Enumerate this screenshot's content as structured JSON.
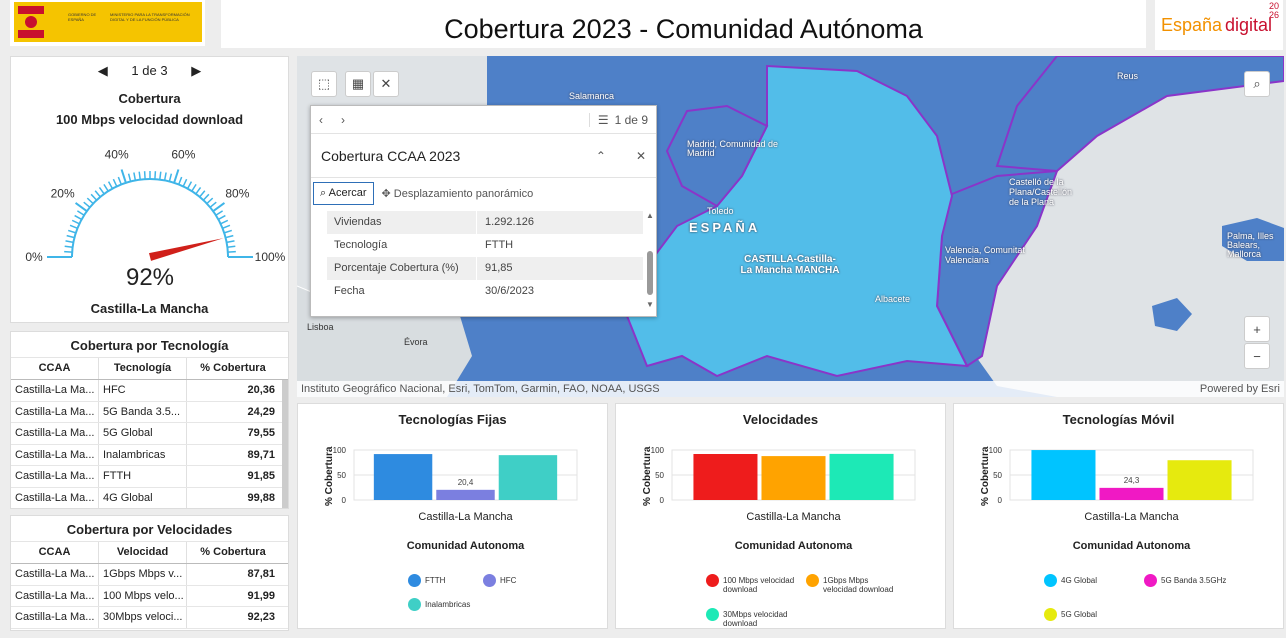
{
  "header": {
    "title": "Cobertura 2023 - Comunidad Autónoma",
    "left_logo_text_1": "GOBIERNO DE ESPAÑA",
    "left_logo_text_2": "MINISTERIO PARA LA TRANSFORMACIÓN DIGITAL Y DE LA FUNCIÓN PÚBLICA",
    "right_logo_text_1": "España",
    "right_logo_text_2": "digital",
    "right_logo_year": "2026"
  },
  "gauge": {
    "pager_label": "1 de 3",
    "title": "Cobertura",
    "subtitle": "100 Mbps velocidad download",
    "value": 92,
    "value_label": "92%",
    "ticks": [
      "0%",
      "20%",
      "40%",
      "60%",
      "80%",
      "100%"
    ],
    "region": "Castilla-La Mancha",
    "accent": "#3fb5e8",
    "needle": "#d0201a"
  },
  "tech_table": {
    "title": "Cobertura por Tecnología",
    "headers": [
      "CCAA",
      "Tecnología",
      "% Cobertura"
    ],
    "rows": [
      [
        "Castilla-La Ma...",
        "HFC",
        "20,36"
      ],
      [
        "Castilla-La Ma...",
        "5G Banda 3.5...",
        "24,29"
      ],
      [
        "Castilla-La Ma...",
        "5G Global",
        "79,55"
      ],
      [
        "Castilla-La Ma...",
        "Inalambricas",
        "89,71"
      ],
      [
        "Castilla-La Ma...",
        "FTTH",
        "91,85"
      ],
      [
        "Castilla-La Ma...",
        "4G Global",
        "99,88"
      ]
    ]
  },
  "speed_table": {
    "title": "Cobertura por Velocidades",
    "headers": [
      "CCAA",
      "Velocidad",
      "% Cobertura"
    ],
    "rows": [
      [
        "Castilla-La Ma...",
        "1Gbps Mbps v...",
        "87,81"
      ],
      [
        "Castilla-La Ma...",
        "100 Mbps velo...",
        "91,99"
      ],
      [
        "Castilla-La Ma...",
        "30Mbps veloci...",
        "92,23"
      ]
    ]
  },
  "map": {
    "attribution": "Instituto Geográfico Nacional, Esri, TomTom, Garmin, FAO, NOAA, USGS",
    "powered": "Powered by Esri",
    "labels": [
      "Salamanca",
      "Madrid, Comunidad de Madrid",
      "Toledo",
      "ESPAÑA",
      "CASTILLA-Castilla-La Mancha MANCHA",
      "Albacete",
      "Castelló de la Plana/Castellón de la Plana",
      "Valencia, Comunitat Valenciana",
      "Reus",
      "Palma, Illes Balears, Mallorca",
      "Lisboa",
      "Évora"
    ],
    "zoom_in": "+",
    "zoom_out": "−",
    "colors": {
      "sea": "#dfe3e6",
      "region": "#4e80c8",
      "selected": "#52bde9",
      "border": "#8a35c9"
    }
  },
  "popup": {
    "pager": "1 de 9",
    "title": "Cobertura CCAA 2023",
    "zoom_label": "Acercar",
    "pan_label": "Desplazamiento panorámico",
    "fields": [
      [
        "Viviendas",
        "1.292.126"
      ],
      [
        "Tecnología",
        "FTTH"
      ],
      [
        "Porcentaje Cobertura (%)",
        "91,85"
      ],
      [
        "Fecha",
        "30/6/2023"
      ]
    ]
  },
  "charts": {
    "fixed": {
      "title": "Tecnologías Fijas",
      "ylabel": "% Cobertura",
      "category": "Castilla-La Mancha",
      "xtitle": "Comunidad Autonoma",
      "legend": [
        "FTTH",
        "HFC",
        "Inalambricas"
      ]
    },
    "speeds": {
      "title": "Velocidades",
      "ylabel": "% Cobertura",
      "category": "Castilla-La Mancha",
      "xtitle": "Comunidad Autonoma",
      "legend": [
        "100 Mbps velocidad download",
        "1Gbps Mbps velocidad download",
        "30Mbps velocidad download"
      ]
    },
    "mobile": {
      "title": "Tecnologías Móvil",
      "ylabel": "% Cobertura",
      "category": "Castilla-La Mancha",
      "xtitle": "Comunidad Autonoma",
      "legend": [
        "4G Global",
        "5G Banda 3.5GHz",
        "5G Global"
      ]
    }
  },
  "chart_data": [
    {
      "type": "bar",
      "title": "Tecnologías Fijas",
      "ylabel": "% Cobertura",
      "xlabel": "Comunidad Autonoma",
      "categories": [
        "Castilla-La Mancha"
      ],
      "ylim": [
        0,
        100
      ],
      "ticks": [
        0,
        50,
        100
      ],
      "series": [
        {
          "name": "FTTH",
          "values": [
            91.85
          ],
          "color": "#2e8be0"
        },
        {
          "name": "HFC",
          "values": [
            20.36
          ],
          "color": "#7b7fe0",
          "label": "20,4"
        },
        {
          "name": "Inalambricas",
          "values": [
            89.71
          ],
          "color": "#3fcfc6"
        }
      ]
    },
    {
      "type": "bar",
      "title": "Velocidades",
      "ylabel": "% Cobertura",
      "xlabel": "Comunidad Autonoma",
      "categories": [
        "Castilla-La Mancha"
      ],
      "ylim": [
        0,
        100
      ],
      "ticks": [
        0,
        50,
        100
      ],
      "series": [
        {
          "name": "100 Mbps velocidad download",
          "values": [
            91.99
          ],
          "color": "#ee1c1c"
        },
        {
          "name": "1Gbps Mbps velocidad download",
          "values": [
            87.81
          ],
          "color": "#ffa300"
        },
        {
          "name": "30Mbps velocidad download",
          "values": [
            92.23
          ],
          "color": "#1de9b6"
        }
      ]
    },
    {
      "type": "bar",
      "title": "Tecnologías Móvil",
      "ylabel": "% Cobertura",
      "xlabel": "Comunidad Autonoma",
      "categories": [
        "Castilla-La Mancha"
      ],
      "ylim": [
        0,
        100
      ],
      "ticks": [
        0,
        50,
        100
      ],
      "series": [
        {
          "name": "4G Global",
          "values": [
            99.88
          ],
          "color": "#00c4ff"
        },
        {
          "name": "5G Banda 3.5GHz",
          "values": [
            24.29
          ],
          "color": "#f019c4",
          "label": "24,3"
        },
        {
          "name": "5G Global",
          "values": [
            79.55
          ],
          "color": "#e6ea0e"
        }
      ]
    }
  ]
}
